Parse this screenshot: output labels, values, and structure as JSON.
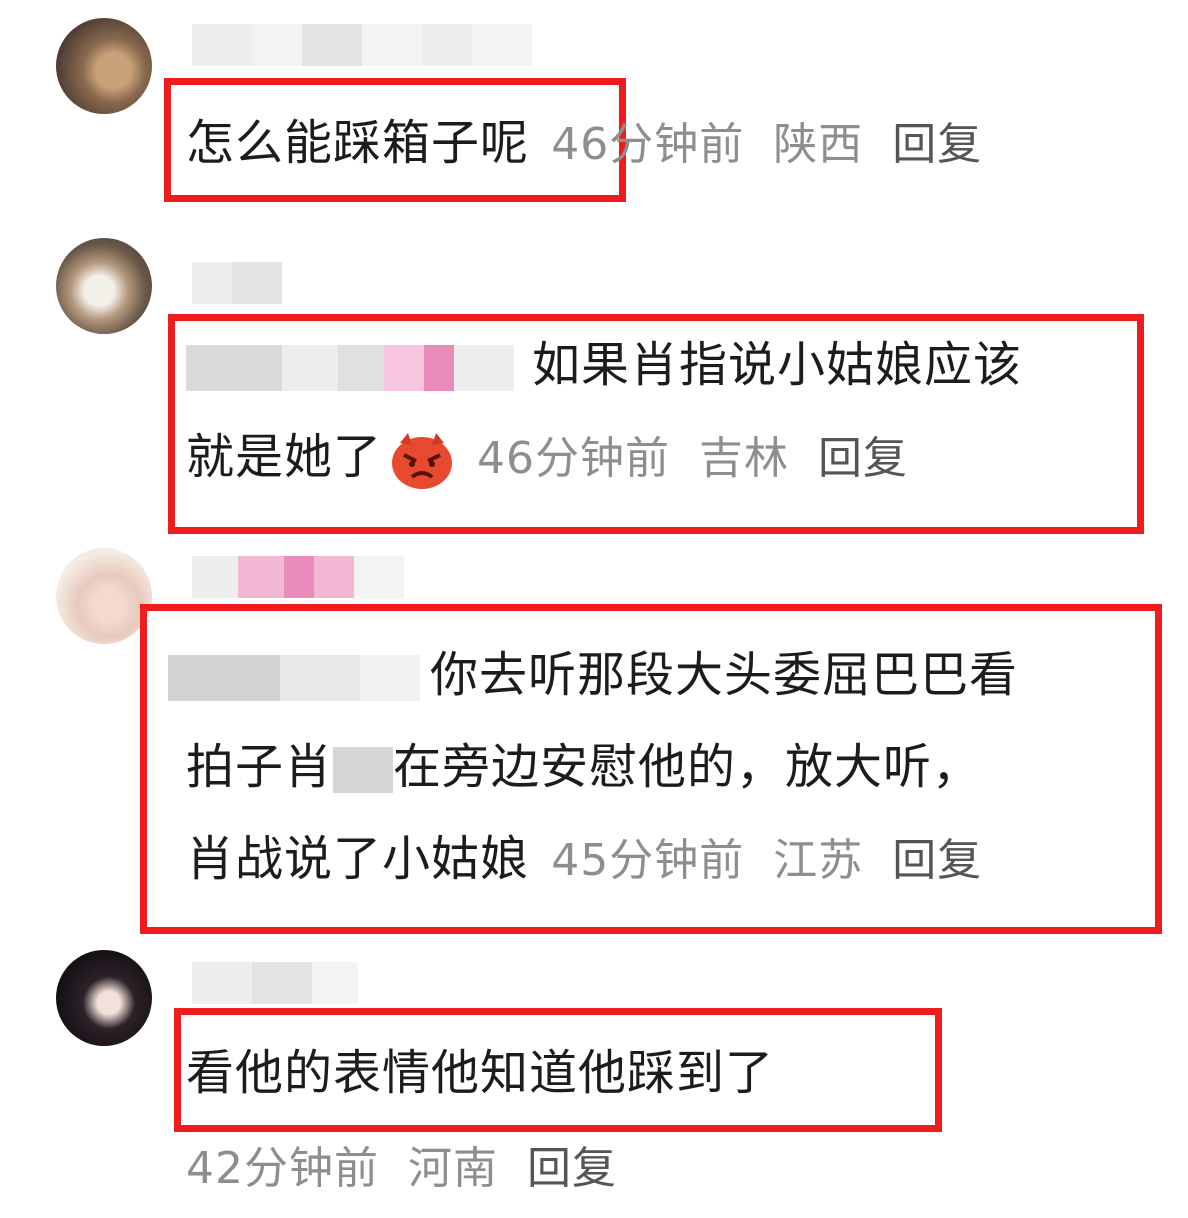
{
  "comments": [
    {
      "text": "怎么能踩箱子呢",
      "time": "46分钟前",
      "region": "陕西",
      "reply": "回复"
    },
    {
      "text_line1": "如果肖指说小姑娘应该",
      "text_line2": "就是她了",
      "emoji": "angry-face-icon",
      "time": "46分钟前",
      "region": "吉林",
      "reply": "回复"
    },
    {
      "text_line1": "你去听那段大头委屈巴巴看",
      "text_line2a": "拍子肖",
      "text_line2b": "在旁边安慰他的，放大听，",
      "text_line3": "肖战说了小姑娘",
      "time": "45分钟前",
      "region": "江苏",
      "reply": "回复"
    },
    {
      "text": "看他的表情他知道他踩到了",
      "time": "42分钟前",
      "region": "河南",
      "reply": "回复"
    }
  ],
  "colors": {
    "highlight_border": "#ee1c1c",
    "meta_text": "#8e8e8e",
    "body_text": "#1c1c1c"
  }
}
